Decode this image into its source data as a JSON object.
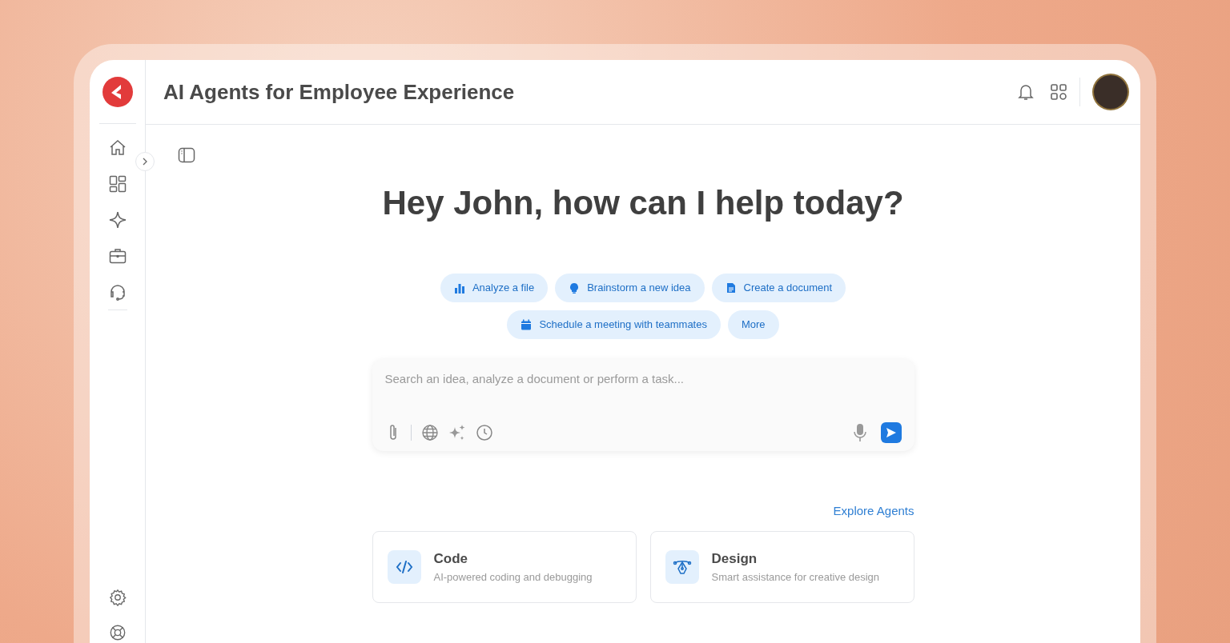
{
  "header": {
    "title": "AI Agents for Employee Experience"
  },
  "greeting": "Hey John, how can I help today?",
  "suggestions": [
    {
      "label": "Analyze a file"
    },
    {
      "label": "Brainstorm a new idea"
    },
    {
      "label": "Create a document"
    },
    {
      "label": "Schedule a meeting with teammates"
    },
    {
      "label": "More"
    }
  ],
  "prompt": {
    "placeholder": "Search an idea, analyze a document or perform a task..."
  },
  "explore_link": "Explore Agents",
  "agents": [
    {
      "title": "Code",
      "description": "AI-powered coding and debugging"
    },
    {
      "title": "Design",
      "description": "Smart assistance for creative design"
    }
  ]
}
